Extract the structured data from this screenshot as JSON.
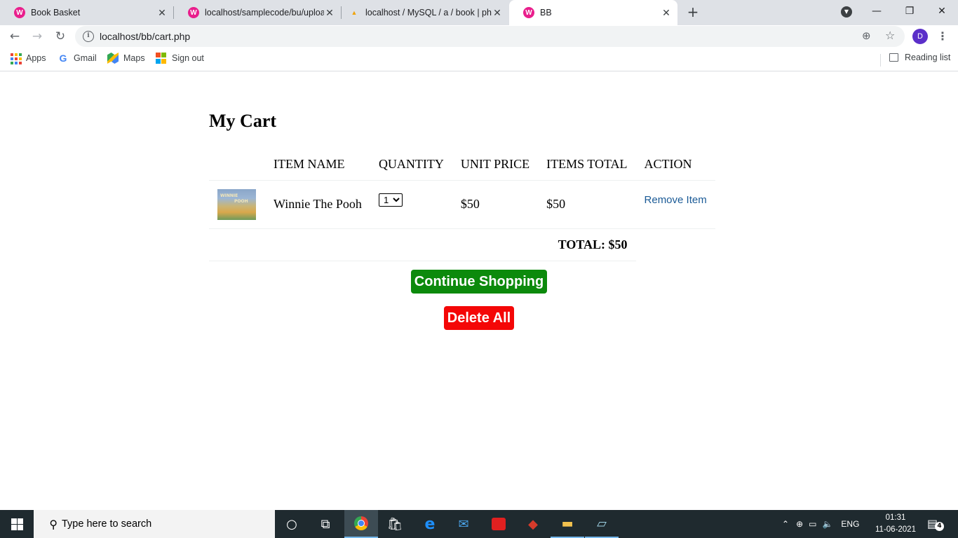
{
  "browser": {
    "tabs": [
      {
        "title": "Book Basket",
        "active": false
      },
      {
        "title": "localhost/samplecode/bu/uploac",
        "active": false
      },
      {
        "title": "localhost / MySQL / a / book | ph",
        "active": false
      },
      {
        "title": "BB",
        "active": true
      }
    ],
    "url": "localhost/bb/cart.php",
    "profile_initial": "D",
    "bookmarks": [
      "Apps",
      "Gmail",
      "Maps",
      "Sign out"
    ],
    "reading_list": "Reading list"
  },
  "page": {
    "heading": "My Cart",
    "columns": [
      "ITEM NAME",
      "QUANTITY",
      "UNIT PRICE",
      "ITEMS TOTAL",
      "ACTION"
    ],
    "items": [
      {
        "thumb_text_1": "WINNIE",
        "thumb_text_2": "POOH",
        "name": "Winnie The Pooh",
        "quantity": "1",
        "unit_price": "$50",
        "items_total": "$50",
        "action": "Remove Item"
      }
    ],
    "total_label": "TOTAL: $50",
    "continue_label": "Continue Shopping",
    "delete_label": "Delete All"
  },
  "taskbar": {
    "search_placeholder": "Type here to search",
    "language": "ENG",
    "time": "01:31",
    "date": "11-06-2021",
    "notification_count": "4"
  },
  "colors": {
    "continue_button": "#0c8a0c",
    "delete_button": "#f40707",
    "link": "#1a5a96",
    "profile_avatar": "#5b2fc9"
  },
  "icons": [
    "back-icon",
    "forward-icon",
    "reload-icon",
    "info-icon",
    "zoom-icon",
    "star-icon",
    "menu-icon",
    "windows-icon",
    "search-icon",
    "chrome-icon",
    "notification-icon"
  ]
}
